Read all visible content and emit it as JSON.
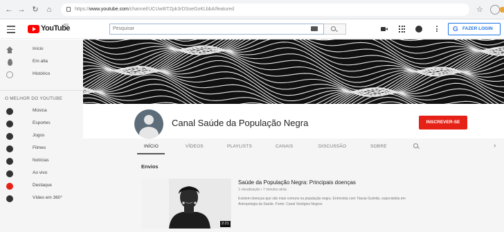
{
  "browser": {
    "url_prefix": "https://",
    "url_host": "www.youtube.com",
    "url_path": "/channel/UCUw8ITZpk3rDSoeGoKLbbA/featured"
  },
  "topbar": {
    "logo_text": "YouTube",
    "logo_region": "BR",
    "search_placeholder": "Pesquisar",
    "login_label": "FAZER LOGIN"
  },
  "sidebar": {
    "items": [
      {
        "label": "Início",
        "icon": "home-icon"
      },
      {
        "label": "Em alta",
        "icon": "trending-icon"
      },
      {
        "label": "Histórico",
        "icon": "history-icon"
      }
    ],
    "section_title": "O MELHOR DO YOUTUBE",
    "best": [
      {
        "label": "Música",
        "icon": "music-icon"
      },
      {
        "label": "Esportes",
        "icon": "sports-icon"
      },
      {
        "label": "Jogos",
        "icon": "gaming-icon"
      },
      {
        "label": "Filmes",
        "icon": "movies-icon"
      },
      {
        "label": "Notícias",
        "icon": "news-icon"
      },
      {
        "label": "Ao vivo",
        "icon": "live-icon"
      },
      {
        "label": "Destaque",
        "icon": "spotlight-icon"
      },
      {
        "label": "Vídeo em 360°",
        "icon": "video-360-icon"
      }
    ]
  },
  "channel": {
    "name": "Canal Saúde da População Negra",
    "subscribe_label": "INSCREVER-SE"
  },
  "tabs": [
    "INÍCIO",
    "VÍDEOS",
    "PLAYLISTS",
    "CANAIS",
    "DISCUSSÃO",
    "SOBRE"
  ],
  "uploads": {
    "section_title": "Envios",
    "video_title": "Saúde da População Negra: Principais doenças",
    "video_meta": "1 visualização • 7 minutos atrás",
    "video_desc": "Existem doenças que são mais comuns na população negra. Entrevista com Tássia Guimão, especialista em Antropologia da Saúde. Fonte: Canal Vestígios Negros",
    "duration": "2:21"
  },
  "colors": {
    "brand_red": "#e62117",
    "login_blue": "#1a73e8"
  }
}
